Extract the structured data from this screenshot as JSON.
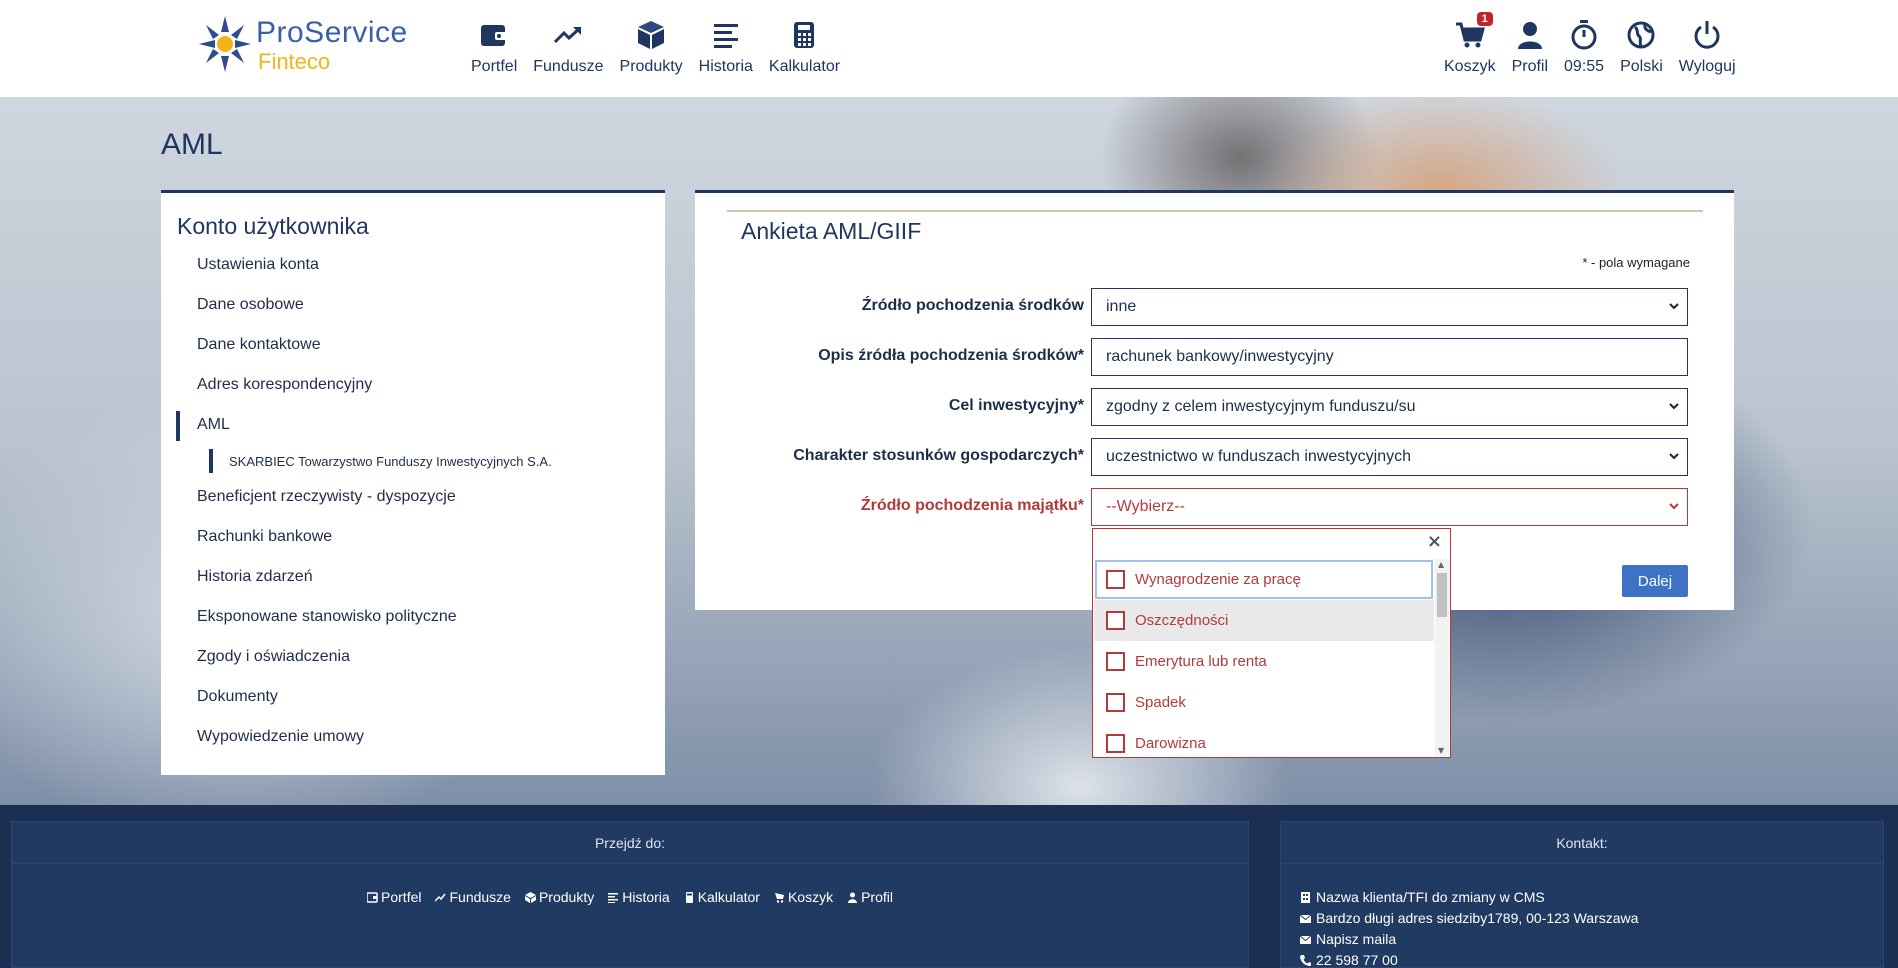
{
  "brand": {
    "name_line1": "ProService",
    "name_line2": "Finteco"
  },
  "nav": {
    "left": [
      {
        "id": "portfel",
        "label": "Portfel",
        "icon": "wallet-icon"
      },
      {
        "id": "fundusze",
        "label": "Fundusze",
        "icon": "trending-up-icon"
      },
      {
        "id": "produkty",
        "label": "Produkty",
        "icon": "box-icon"
      },
      {
        "id": "historia",
        "label": "Historia",
        "icon": "list-icon"
      },
      {
        "id": "kalkulator",
        "label": "Kalkulator",
        "icon": "calculator-icon"
      }
    ],
    "right": [
      {
        "id": "koszyk",
        "label": "Koszyk",
        "icon": "cart-icon",
        "badge": "1"
      },
      {
        "id": "profil",
        "label": "Profil",
        "icon": "user-icon"
      },
      {
        "id": "timer",
        "label": "09:55",
        "icon": "stopwatch-icon"
      },
      {
        "id": "lang",
        "label": "Polski",
        "icon": "globe-icon"
      },
      {
        "id": "logout",
        "label": "Wyloguj",
        "icon": "power-icon"
      }
    ]
  },
  "page": {
    "title": "AML"
  },
  "sidebar": {
    "heading": "Konto użytkownika",
    "items": [
      "Ustawienia konta",
      "Dane osobowe",
      "Dane kontaktowe",
      "Adres korespondencyjny",
      "AML",
      "Beneficjent rzeczywisty - dyspozycje",
      "Rachunki bankowe",
      "Historia zdarzeń",
      "Eksponowane stanowisko polityczne",
      "Zgody i oświadczenia",
      "Dokumenty",
      "Wypowiedzenie umowy"
    ],
    "active_item": "AML",
    "sub_item": "SKARBIEC Towarzystwo Funduszy Inwestycyjnych S.A."
  },
  "form": {
    "title": "Ankieta AML/GIIF",
    "required_note": "* - pola wymagane",
    "fields": [
      {
        "label": "Źródło pochodzenia środków",
        "value": "inne",
        "type": "select"
      },
      {
        "label": "Opis źródła pochodzenia środków*",
        "value": "rachunek bankowy/inwestycyjny",
        "type": "text"
      },
      {
        "label": "Cel inwestycyjny*",
        "value": "zgodny z celem inwestycyjnym funduszu/su",
        "type": "select"
      },
      {
        "label": "Charakter stosunków gospodarczych*",
        "value": "uczestnictwo w funduszach inwestycyjnych",
        "type": "select"
      },
      {
        "label": "Źródło pochodzenia majątku*",
        "value": "--Wybierz--",
        "type": "select",
        "error": true
      }
    ],
    "next_label": "Dalej",
    "dropdown": {
      "close": "×",
      "options": [
        {
          "label": "Wynagrodzenie za pracę",
          "checked": false
        },
        {
          "label": "Oszczędności",
          "checked": false
        },
        {
          "label": "Emerytura lub renta",
          "checked": false
        },
        {
          "label": "Spadek",
          "checked": false
        },
        {
          "label": "Darowizna",
          "checked": false
        }
      ]
    }
  },
  "footer": {
    "links_heading": "Przejdź do:",
    "links": [
      "Portfel",
      "Fundusze",
      "Produkty",
      "Historia",
      "Kalkulator",
      "Koszyk",
      "Profil"
    ],
    "contact_heading": "Kontakt:",
    "contact": [
      {
        "icon": "building-icon",
        "text": "Nazwa klienta/TFI do zmiany w CMS"
      },
      {
        "icon": "envelope-icon",
        "text": "Bardzo długi adres siedziby1789, 00-123 Warszawa"
      },
      {
        "icon": "envelope-icon",
        "text": "Napisz maila"
      },
      {
        "icon": "phone-icon",
        "text": "22 598 77 00"
      }
    ]
  },
  "colors": {
    "navy": "#1e3660",
    "accent_yellow": "#f3b417",
    "error": "#b33a3a",
    "button": "#3d72c4",
    "footer": "#1b2f52"
  }
}
